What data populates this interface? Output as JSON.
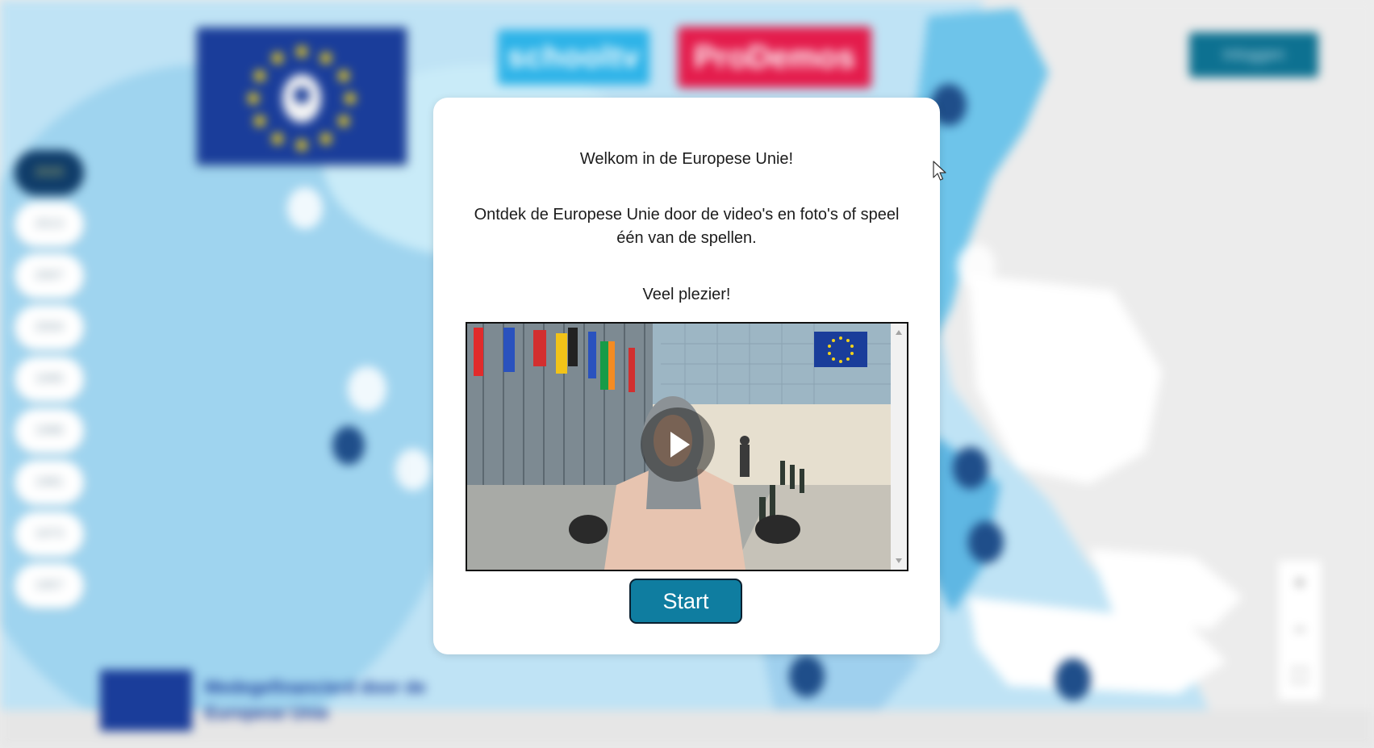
{
  "background": {
    "logos": {
      "schooltv": "schooltv",
      "prodemos": "ProDemos"
    },
    "login_label": "Inloggen",
    "years": [
      "2020",
      "2013",
      "2007",
      "2004",
      "1995",
      "1986",
      "1981",
      "1973",
      "1957"
    ],
    "active_year_index": 0,
    "zoom": {
      "in": "+",
      "out": "−",
      "fullscreen": "⛶"
    },
    "cofunded_text": "Medegefinancierd door de Europese Unie"
  },
  "modal": {
    "welcome": "Welkom in de Europese Unie!",
    "intro": "Ontdek de Europese Unie door de video's en foto's of speel één van de spellen.",
    "fun": "Veel plezier!",
    "start_label": "Start"
  },
  "colors": {
    "start_button": "#0f7da0",
    "eu_blue": "#1a3d9a",
    "eu_gold": "#f2d21b",
    "prodemos": "#e41c4c",
    "schooltv": "#2db3e8"
  },
  "icons": [
    "play-icon",
    "cursor-icon",
    "scroll-up-icon",
    "scroll-down-icon",
    "map-pin-icon"
  ]
}
